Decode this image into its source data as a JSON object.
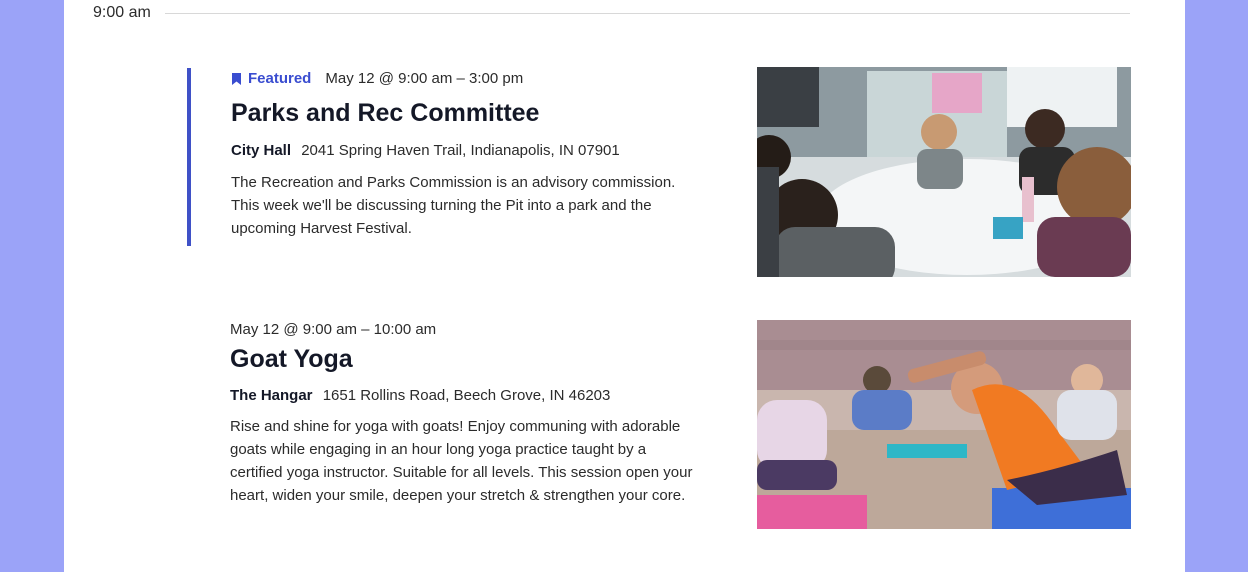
{
  "timeline": {
    "time_label": "9:00 am"
  },
  "events": [
    {
      "featured_label": "Featured",
      "datetime": "May 12 @ 9:00 am – 3:00 pm",
      "title": "Parks and Rec Committee",
      "venue_name": "City Hall",
      "venue_address": "2041 Spring Haven Trail, Indianapolis, IN 07901",
      "description": "The Recreation and Parks Commission is an advisory commission. This week we'll be discussing turning the Pit into a park and the upcoming Harvest Festival.",
      "image": "meeting-photo"
    },
    {
      "datetime": "May 12 @ 9:00 am – 10:00 am",
      "title": "Goat Yoga",
      "venue_name": "The Hangar",
      "venue_address": "1651 Rollins Road, Beech Grove, IN 46203",
      "description": "Rise and shine for yoga with goats! Enjoy communing with adorable goats while engaging in an hour long yoga practice taught by a certified yoga instructor. Suitable for all levels. This session open your heart, widen your smile, deepen your stretch & strengthen your core.",
      "image": "yoga-photo"
    }
  ],
  "colors": {
    "background": "#9ba3f8",
    "accent": "#3a4dd0",
    "featured_bar": "#3f51c7",
    "text": "#141827"
  },
  "icons": {
    "featured": "bookmark-icon"
  }
}
